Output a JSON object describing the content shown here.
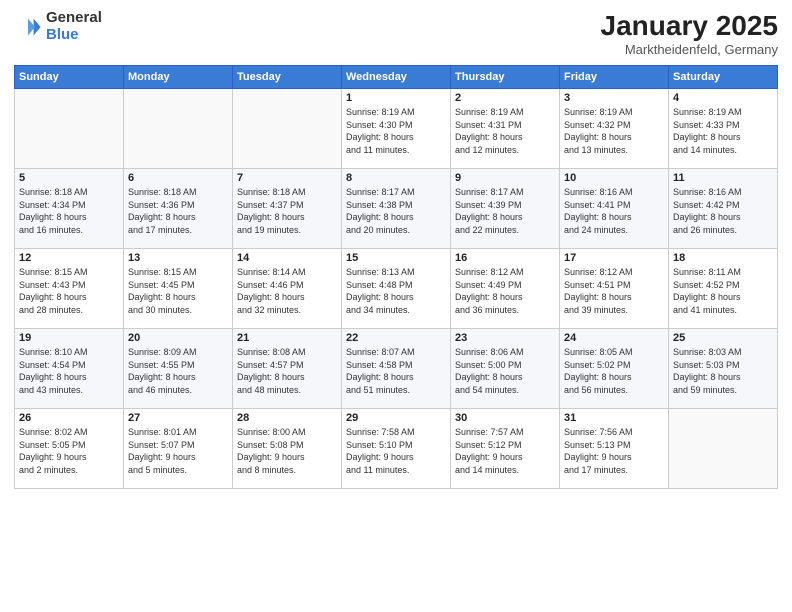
{
  "logo": {
    "general": "General",
    "blue": "Blue"
  },
  "title": "January 2025",
  "subtitle": "Marktheidenfeld, Germany",
  "days_header": [
    "Sunday",
    "Monday",
    "Tuesday",
    "Wednesday",
    "Thursday",
    "Friday",
    "Saturday"
  ],
  "weeks": [
    [
      {
        "day": "",
        "data": ""
      },
      {
        "day": "",
        "data": ""
      },
      {
        "day": "",
        "data": ""
      },
      {
        "day": "1",
        "data": "Sunrise: 8:19 AM\nSunset: 4:30 PM\nDaylight: 8 hours\nand 11 minutes."
      },
      {
        "day": "2",
        "data": "Sunrise: 8:19 AM\nSunset: 4:31 PM\nDaylight: 8 hours\nand 12 minutes."
      },
      {
        "day": "3",
        "data": "Sunrise: 8:19 AM\nSunset: 4:32 PM\nDaylight: 8 hours\nand 13 minutes."
      },
      {
        "day": "4",
        "data": "Sunrise: 8:19 AM\nSunset: 4:33 PM\nDaylight: 8 hours\nand 14 minutes."
      }
    ],
    [
      {
        "day": "5",
        "data": "Sunrise: 8:18 AM\nSunset: 4:34 PM\nDaylight: 8 hours\nand 16 minutes."
      },
      {
        "day": "6",
        "data": "Sunrise: 8:18 AM\nSunset: 4:36 PM\nDaylight: 8 hours\nand 17 minutes."
      },
      {
        "day": "7",
        "data": "Sunrise: 8:18 AM\nSunset: 4:37 PM\nDaylight: 8 hours\nand 19 minutes."
      },
      {
        "day": "8",
        "data": "Sunrise: 8:17 AM\nSunset: 4:38 PM\nDaylight: 8 hours\nand 20 minutes."
      },
      {
        "day": "9",
        "data": "Sunrise: 8:17 AM\nSunset: 4:39 PM\nDaylight: 8 hours\nand 22 minutes."
      },
      {
        "day": "10",
        "data": "Sunrise: 8:16 AM\nSunset: 4:41 PM\nDaylight: 8 hours\nand 24 minutes."
      },
      {
        "day": "11",
        "data": "Sunrise: 8:16 AM\nSunset: 4:42 PM\nDaylight: 8 hours\nand 26 minutes."
      }
    ],
    [
      {
        "day": "12",
        "data": "Sunrise: 8:15 AM\nSunset: 4:43 PM\nDaylight: 8 hours\nand 28 minutes."
      },
      {
        "day": "13",
        "data": "Sunrise: 8:15 AM\nSunset: 4:45 PM\nDaylight: 8 hours\nand 30 minutes."
      },
      {
        "day": "14",
        "data": "Sunrise: 8:14 AM\nSunset: 4:46 PM\nDaylight: 8 hours\nand 32 minutes."
      },
      {
        "day": "15",
        "data": "Sunrise: 8:13 AM\nSunset: 4:48 PM\nDaylight: 8 hours\nand 34 minutes."
      },
      {
        "day": "16",
        "data": "Sunrise: 8:12 AM\nSunset: 4:49 PM\nDaylight: 8 hours\nand 36 minutes."
      },
      {
        "day": "17",
        "data": "Sunrise: 8:12 AM\nSunset: 4:51 PM\nDaylight: 8 hours\nand 39 minutes."
      },
      {
        "day": "18",
        "data": "Sunrise: 8:11 AM\nSunset: 4:52 PM\nDaylight: 8 hours\nand 41 minutes."
      }
    ],
    [
      {
        "day": "19",
        "data": "Sunrise: 8:10 AM\nSunset: 4:54 PM\nDaylight: 8 hours\nand 43 minutes."
      },
      {
        "day": "20",
        "data": "Sunrise: 8:09 AM\nSunset: 4:55 PM\nDaylight: 8 hours\nand 46 minutes."
      },
      {
        "day": "21",
        "data": "Sunrise: 8:08 AM\nSunset: 4:57 PM\nDaylight: 8 hours\nand 48 minutes."
      },
      {
        "day": "22",
        "data": "Sunrise: 8:07 AM\nSunset: 4:58 PM\nDaylight: 8 hours\nand 51 minutes."
      },
      {
        "day": "23",
        "data": "Sunrise: 8:06 AM\nSunset: 5:00 PM\nDaylight: 8 hours\nand 54 minutes."
      },
      {
        "day": "24",
        "data": "Sunrise: 8:05 AM\nSunset: 5:02 PM\nDaylight: 8 hours\nand 56 minutes."
      },
      {
        "day": "25",
        "data": "Sunrise: 8:03 AM\nSunset: 5:03 PM\nDaylight: 8 hours\nand 59 minutes."
      }
    ],
    [
      {
        "day": "26",
        "data": "Sunrise: 8:02 AM\nSunset: 5:05 PM\nDaylight: 9 hours\nand 2 minutes."
      },
      {
        "day": "27",
        "data": "Sunrise: 8:01 AM\nSunset: 5:07 PM\nDaylight: 9 hours\nand 5 minutes."
      },
      {
        "day": "28",
        "data": "Sunrise: 8:00 AM\nSunset: 5:08 PM\nDaylight: 9 hours\nand 8 minutes."
      },
      {
        "day": "29",
        "data": "Sunrise: 7:58 AM\nSunset: 5:10 PM\nDaylight: 9 hours\nand 11 minutes."
      },
      {
        "day": "30",
        "data": "Sunrise: 7:57 AM\nSunset: 5:12 PM\nDaylight: 9 hours\nand 14 minutes."
      },
      {
        "day": "31",
        "data": "Sunrise: 7:56 AM\nSunset: 5:13 PM\nDaylight: 9 hours\nand 17 minutes."
      },
      {
        "day": "",
        "data": ""
      }
    ]
  ]
}
